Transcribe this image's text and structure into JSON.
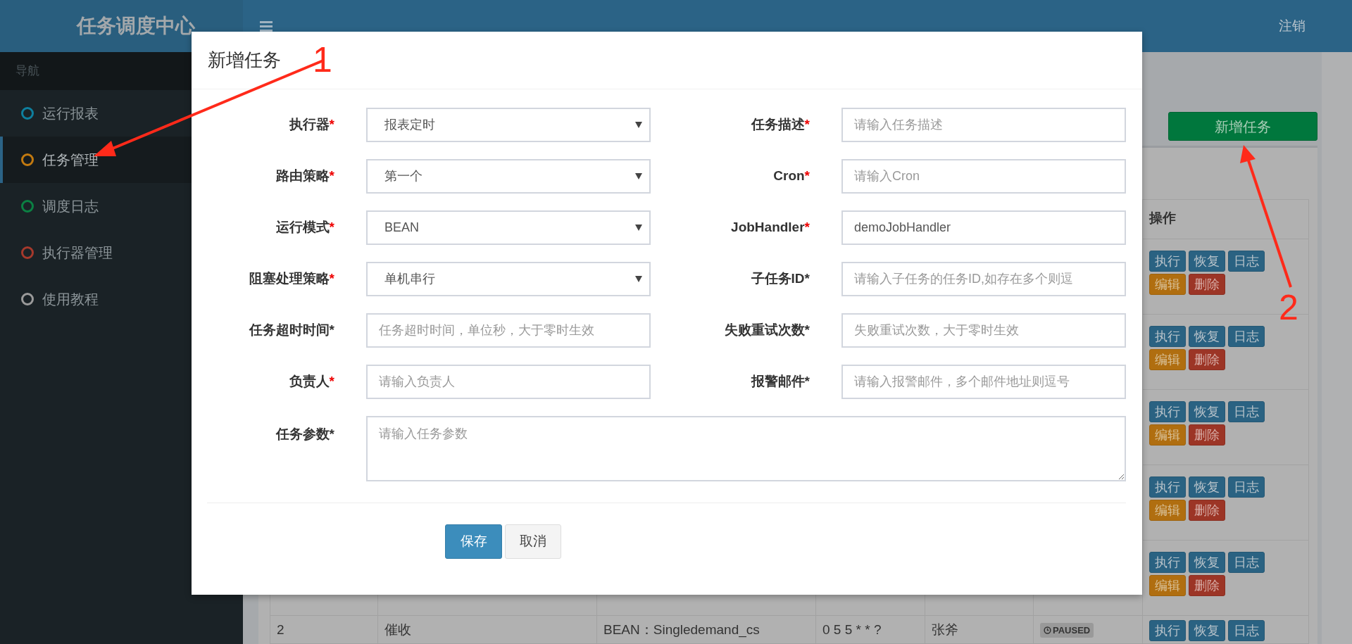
{
  "sidebar": {
    "title": "任务调度中心",
    "nav_header": "导航",
    "items": [
      {
        "label": "运行报表",
        "color": "#0e7f9e",
        "selected": false
      },
      {
        "label": "任务管理",
        "color": "#c27a10",
        "selected": true
      },
      {
        "label": "调度日志",
        "color": "#0b8043",
        "selected": false
      },
      {
        "label": "执行器管理",
        "color": "#a5392c",
        "selected": false
      },
      {
        "label": "使用教程",
        "color": "#9a9a9a",
        "selected": false
      }
    ]
  },
  "topbar": {
    "logout": "注销"
  },
  "page": {
    "add_button": "新增任务"
  },
  "table": {
    "header": "操作",
    "rows": [
      {
        "actions": [
          {
            "label": "执行",
            "kind": "primary"
          },
          {
            "label": "恢复",
            "kind": "primary"
          },
          {
            "label": "日志",
            "kind": "primary"
          },
          {
            "label": "编辑",
            "kind": "warning"
          },
          {
            "label": "删除",
            "kind": "danger"
          }
        ]
      },
      {
        "actions": [
          {
            "label": "执行",
            "kind": "primary"
          },
          {
            "label": "恢复",
            "kind": "primary"
          },
          {
            "label": "日志",
            "kind": "primary"
          },
          {
            "label": "编辑",
            "kind": "warning"
          },
          {
            "label": "删除",
            "kind": "danger"
          }
        ]
      },
      {
        "actions": [
          {
            "label": "执行",
            "kind": "primary"
          },
          {
            "label": "恢复",
            "kind": "primary"
          },
          {
            "label": "日志",
            "kind": "primary"
          },
          {
            "label": "编辑",
            "kind": "warning"
          },
          {
            "label": "删除",
            "kind": "danger"
          }
        ]
      },
      {
        "actions": [
          {
            "label": "执行",
            "kind": "primary"
          },
          {
            "label": "恢复",
            "kind": "primary"
          },
          {
            "label": "日志",
            "kind": "primary"
          },
          {
            "label": "编辑",
            "kind": "warning"
          },
          {
            "label": "删除",
            "kind": "danger"
          }
        ]
      },
      {
        "actions": [
          {
            "label": "执行",
            "kind": "primary"
          },
          {
            "label": "恢复",
            "kind": "primary"
          },
          {
            "label": "日志",
            "kind": "primary"
          },
          {
            "label": "编辑",
            "kind": "warning"
          },
          {
            "label": "删除",
            "kind": "danger"
          }
        ]
      },
      {
        "cells": [
          "2",
          "催收",
          "BEAN：Singledemand_cs",
          "0 5 5 * * ?",
          "张斧"
        ],
        "status": "PAUSED",
        "actions": [
          {
            "label": "执行",
            "kind": "primary"
          },
          {
            "label": "恢复",
            "kind": "primary"
          },
          {
            "label": "日志",
            "kind": "primary"
          }
        ]
      }
    ]
  },
  "modal": {
    "title": "新增任务",
    "fields": [
      {
        "label": "执行器",
        "marker": "*",
        "marker_red": true,
        "kind": "select",
        "value": "报表定时"
      },
      {
        "label": "任务描述",
        "marker": "*",
        "marker_red": true,
        "kind": "input",
        "placeholder": "请输入任务描述"
      },
      {
        "label": "路由策略",
        "marker": "*",
        "marker_red": true,
        "kind": "select",
        "value": "第一个"
      },
      {
        "label": "Cron",
        "marker": "*",
        "marker_red": true,
        "kind": "input",
        "placeholder": "请输入Cron"
      },
      {
        "label": "运行模式",
        "marker": "*",
        "marker_red": true,
        "kind": "select",
        "value": "BEAN"
      },
      {
        "label": "JobHandler",
        "marker": "*",
        "marker_red": true,
        "kind": "input",
        "value": "demoJobHandler"
      },
      {
        "label": "阻塞处理策略",
        "marker": "*",
        "marker_red": true,
        "kind": "select",
        "value": "单机串行"
      },
      {
        "label": "子任务ID",
        "marker": "*",
        "marker_red": false,
        "kind": "input",
        "placeholder": "请输入子任务的任务ID,如存在多个则逗"
      },
      {
        "label": "任务超时时间",
        "marker": "*",
        "marker_red": false,
        "kind": "input",
        "placeholder": "任务超时时间，单位秒，大于零时生效"
      },
      {
        "label": "失败重试次数",
        "marker": "*",
        "marker_red": false,
        "kind": "input",
        "placeholder": "失败重试次数，大于零时生效"
      },
      {
        "label": "负责人",
        "marker": "*",
        "marker_red": true,
        "kind": "input",
        "placeholder": "请输入负责人"
      },
      {
        "label": "报警邮件",
        "marker": "*",
        "marker_red": false,
        "kind": "input",
        "placeholder": "请输入报警邮件，多个邮件地址则逗号"
      },
      {
        "label": "任务参数",
        "marker": "*",
        "marker_red": false,
        "kind": "textarea",
        "placeholder": "请输入任务参数"
      }
    ],
    "buttons": [
      {
        "label": "保存",
        "kind": "primary"
      },
      {
        "label": "取消",
        "kind": "default"
      }
    ]
  },
  "annotations": [
    {
      "label": "1"
    },
    {
      "label": "2"
    }
  ]
}
